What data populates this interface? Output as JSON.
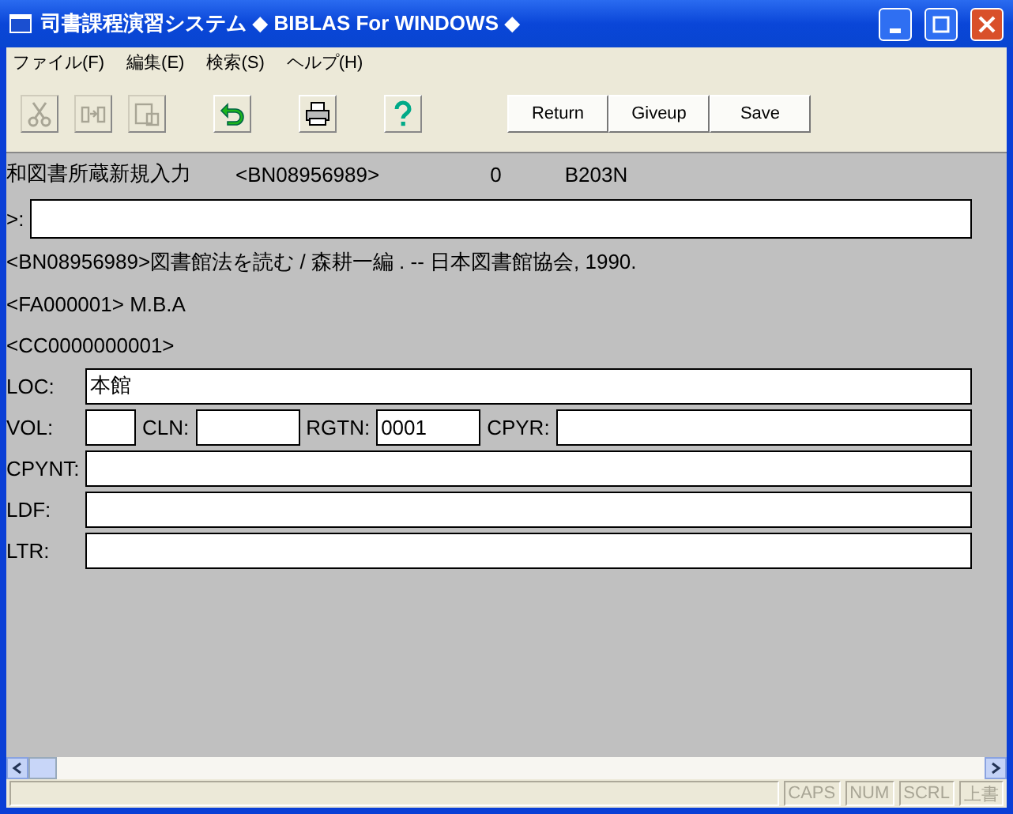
{
  "window": {
    "title": "司書課程演習システム ◆ BIBLAS For WINDOWS ◆"
  },
  "menu": [
    "ファイル(F)",
    "編集(E)",
    "検索(S)",
    "ヘルプ(H)"
  ],
  "toolbar": {
    "tools": [
      {
        "kind": "cut",
        "disabled": true
      },
      {
        "kind": "copy",
        "disabled": true
      },
      {
        "kind": "paste",
        "disabled": true
      },
      {
        "kind": "undo",
        "disabled": false
      },
      {
        "kind": "print",
        "disabled": false
      },
      {
        "kind": "help",
        "disabled": false
      }
    ],
    "buttons": [
      "Return",
      "Giveup",
      "Save"
    ]
  },
  "header": {
    "title": "和図書所蔵新規入力",
    "record_id": "<BN08956989>",
    "count": "0",
    "code": "B203N"
  },
  "prompt": {
    "label": ">:"
  },
  "lines": [
    "<BN08956989>図書館法を読む / 森耕一編 .  -- 日本図書館協会, 1990.",
    "<FA000001> M.B.A",
    "<CC0000000001>"
  ],
  "form_rows": [
    [
      {
        "label": "LOC:",
        "value": "本館",
        "kind": "wide"
      }
    ],
    [
      {
        "label": "VOL:",
        "kind": "tiny"
      },
      {
        "label": "CLN:",
        "kind": "short"
      },
      {
        "label": "RGTN:",
        "value": "0001",
        "kind": "short"
      },
      {
        "label": "CPYR:",
        "kind": "wide"
      }
    ],
    [
      {
        "label": "CPYNT:",
        "kind": "wide"
      }
    ],
    [
      {
        "label": "LDF:",
        "kind": "wide"
      }
    ],
    [
      {
        "label": "LTR:",
        "kind": "wide"
      }
    ]
  ],
  "status_bar": {
    "indicators": [
      "CAPS",
      "NUM",
      "SCRL",
      "上書"
    ]
  }
}
